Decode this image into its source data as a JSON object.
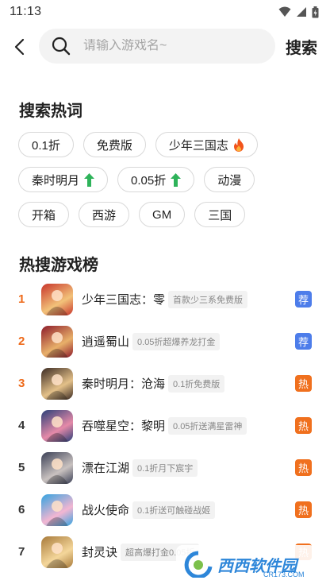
{
  "status": {
    "time": "11:13"
  },
  "header": {
    "search_placeholder": "请输入游戏名~",
    "search_action": "搜索"
  },
  "hot_words": {
    "title": "搜索热词",
    "rows": [
      [
        {
          "label": "0.1折",
          "icon": null
        },
        {
          "label": "免费版",
          "icon": null
        },
        {
          "label": "少年三国志",
          "icon": "fire-icon"
        }
      ],
      [
        {
          "label": "秦时明月",
          "icon": "up-arrow-icon"
        },
        {
          "label": "0.05折",
          "icon": "up-arrow-icon"
        },
        {
          "label": "动漫",
          "icon": null
        }
      ],
      [
        {
          "label": "开箱",
          "icon": null
        },
        {
          "label": "西游",
          "icon": null
        },
        {
          "label": "GM",
          "icon": null
        },
        {
          "label": "三国",
          "icon": null
        }
      ]
    ]
  },
  "hot_list": {
    "title": "热搜游戏榜",
    "items": [
      {
        "rank": "1",
        "name": "少年三国志：零",
        "tag": "首款少三系免费版",
        "badge": "荐",
        "badge_color": "blue",
        "icon_colors": [
          "#c8352b",
          "#f2c27a"
        ]
      },
      {
        "rank": "2",
        "name": "逍遥蜀山",
        "tag": "0.05折超爆养龙打金",
        "badge": "荐",
        "badge_color": "blue",
        "icon_colors": [
          "#8d1a2a",
          "#e8b06a"
        ]
      },
      {
        "rank": "3",
        "name": "秦时明月：沧海",
        "tag": "0.1折免费版",
        "badge": "热",
        "badge_color": "orange",
        "icon_colors": [
          "#3b2a22",
          "#e3c089"
        ]
      },
      {
        "rank": "4",
        "name": "吞噬星空：黎明",
        "tag": "0.05折送满星雷神",
        "badge": "热",
        "badge_color": "orange",
        "icon_colors": [
          "#2a3f78",
          "#e58aa8"
        ]
      },
      {
        "rank": "5",
        "name": "漂在江湖",
        "tag": "0.1折月下宸宇",
        "badge": "热",
        "badge_color": "orange",
        "icon_colors": [
          "#3a3f55",
          "#c9c2c0"
        ]
      },
      {
        "rank": "6",
        "name": "战火使命",
        "tag": "0.1折送可触碰战姬",
        "badge": "热",
        "badge_color": "orange",
        "icon_colors": [
          "#33a3e0",
          "#f3b6d2"
        ]
      },
      {
        "rank": "7",
        "name": "封灵诀",
        "tag": "超高爆打金0.05折",
        "badge": "热",
        "badge_color": "orange",
        "icon_colors": [
          "#a87a3a",
          "#f4d69a"
        ]
      }
    ]
  },
  "watermark": {
    "text": "西西软件园",
    "sub": "CR173.COM"
  },
  "colors": {
    "accent_orange": "#ee6a1a",
    "badge_blue": "#4d7dea",
    "badge_orange": "#f0701e"
  }
}
